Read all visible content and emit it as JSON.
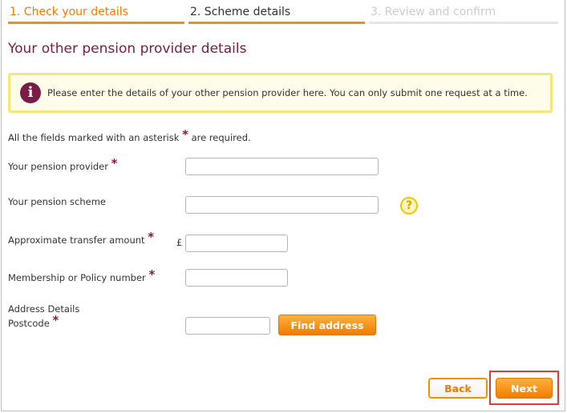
{
  "steps": [
    {
      "label": "1. Check your details",
      "state": "active"
    },
    {
      "label": "2. Scheme details",
      "state": "upcoming"
    },
    {
      "label": "3. Review and confirm",
      "state": "disabled"
    }
  ],
  "page_title": "Your other pension provider details",
  "info": {
    "icon": "info-icon",
    "glyph": "i",
    "text": "Please enter the details of your other pension provider here. You can only submit one request at a time."
  },
  "required_note": {
    "before": "All the fields marked with an asterisk",
    "after": "are required."
  },
  "asterisk": "*",
  "fields": {
    "provider": {
      "label": "Your pension provider",
      "value": ""
    },
    "scheme": {
      "label": "Your pension scheme",
      "value": ""
    },
    "transfer_amount": {
      "label": "Approximate transfer amount",
      "currency": "£",
      "value": ""
    },
    "membership": {
      "label": "Membership or Policy number",
      "value": ""
    },
    "address": {
      "label_line1": "Address Details",
      "label_line2": "Postcode",
      "value": ""
    }
  },
  "help": {
    "glyph": "?"
  },
  "buttons": {
    "find_address": "Find address",
    "back": "Back",
    "next": "Next"
  },
  "colors": {
    "accent": "#f39200",
    "brand": "#7a1c45",
    "info_border": "#f5e67a",
    "highlight": "#e53935"
  }
}
